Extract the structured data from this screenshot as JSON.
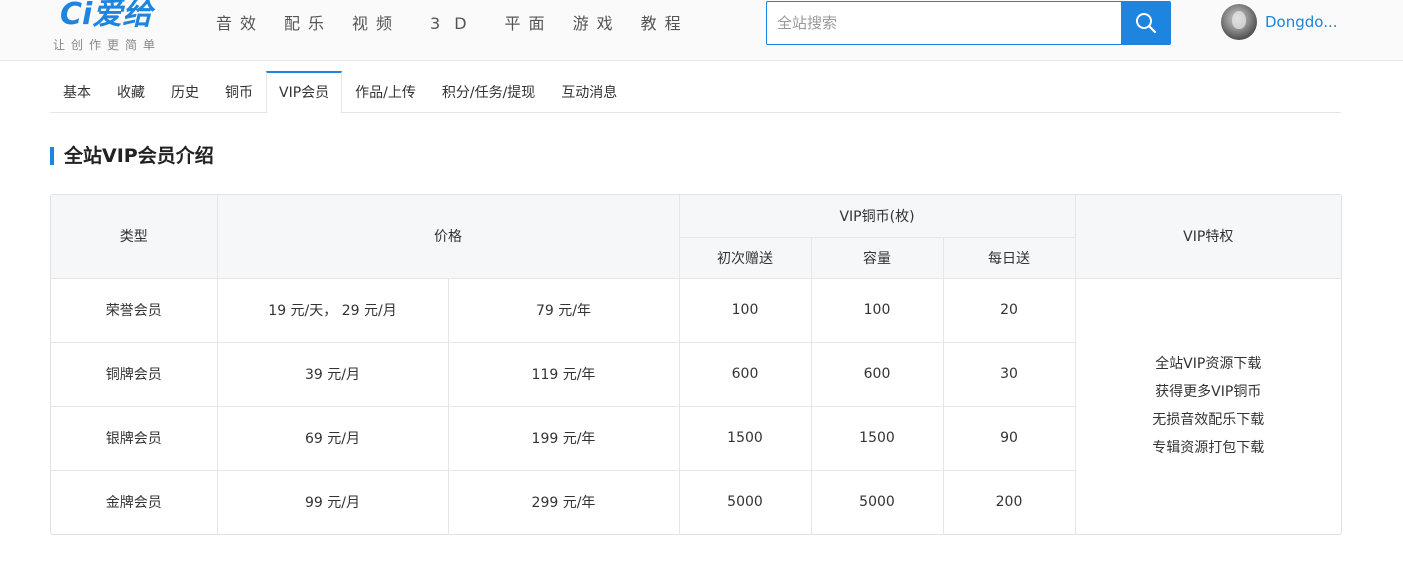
{
  "header": {
    "logo": {
      "mark": "Ci",
      "name": "爱给",
      "slogan": "让创作更简单"
    },
    "nav": [
      "音效",
      "配乐",
      "视频",
      "3D",
      "平面",
      "游戏",
      "教程"
    ],
    "search": {
      "placeholder": "全站搜索",
      "value": ""
    },
    "user": {
      "name": "Dongdo..."
    }
  },
  "tabs": {
    "items": [
      "基本",
      "收藏",
      "历史",
      "铜币",
      "VIP会员",
      "作品/上传",
      "积分/任务/提现",
      "互动消息"
    ],
    "active": "VIP会员"
  },
  "section": {
    "title": "全站VIP会员介绍"
  },
  "vip_table": {
    "headers": {
      "type": "类型",
      "price": "价格",
      "coins": "VIP铜币(枚)",
      "coins_sub": [
        "初次赠送",
        "容量",
        "每日送"
      ],
      "privilege": "VIP特权"
    },
    "rows": [
      {
        "type": "荣誉会员",
        "price_short": "19 元/天， 29 元/月",
        "price_year": "79 元/年",
        "initial": "100",
        "capacity": "100",
        "daily": "20"
      },
      {
        "type": "铜牌会员",
        "price_short": "39 元/月",
        "price_year": "119 元/年",
        "initial": "600",
        "capacity": "600",
        "daily": "30"
      },
      {
        "type": "银牌会员",
        "price_short": "69 元/月",
        "price_year": "199 元/年",
        "initial": "1500",
        "capacity": "1500",
        "daily": "90"
      },
      {
        "type": "金牌会员",
        "price_short": "99 元/月",
        "price_year": "299 元/年",
        "initial": "5000",
        "capacity": "5000",
        "daily": "200"
      }
    ],
    "privileges": [
      "全站VIP资源下载",
      "获得更多VIP铜币",
      "无损音效配乐下载",
      "专辑资源打包下载"
    ]
  },
  "colors": {
    "accent": "#1d84e0",
    "header_bg": "#fafafa",
    "table_header_bg": "#f6f7f9"
  }
}
